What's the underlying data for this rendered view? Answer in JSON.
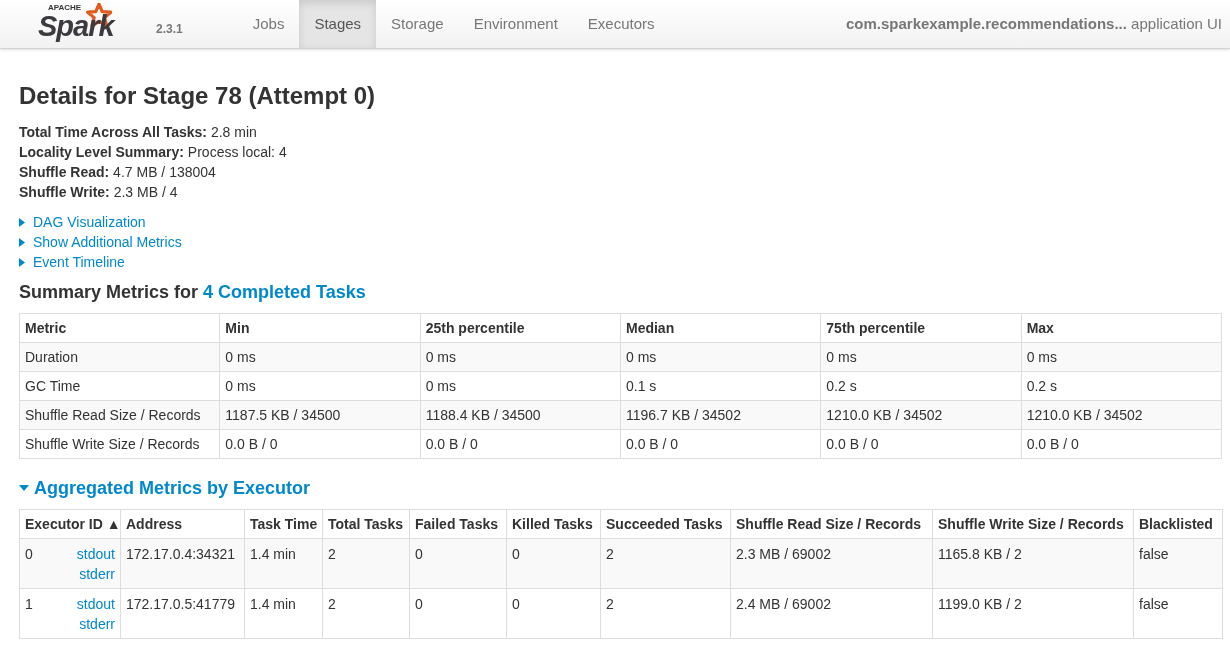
{
  "navbar": {
    "logo": {
      "small": "APACHE",
      "word": "Spark"
    },
    "version": "2.3.1",
    "tabs": [
      {
        "label": "Jobs",
        "selected": false
      },
      {
        "label": "Stages",
        "selected": true
      },
      {
        "label": "Storage",
        "selected": false
      },
      {
        "label": "Environment",
        "selected": false
      },
      {
        "label": "Executors",
        "selected": false
      }
    ],
    "app_name": "com.sparkexample.recommendations...",
    "app_suffix": "application UI"
  },
  "title": "Details for Stage 78 (Attempt 0)",
  "summary": [
    {
      "label": "Total Time Across All Tasks:",
      "value": "2.8 min"
    },
    {
      "label": "Locality Level Summary:",
      "value": "Process local: 4"
    },
    {
      "label": "Shuffle Read:",
      "value": "4.7 MB / 138004"
    },
    {
      "label": "Shuffle Write:",
      "value": "2.3 MB / 4"
    }
  ],
  "toggles": [
    {
      "label": "DAG Visualization",
      "expanded": false
    },
    {
      "label": "Show Additional Metrics",
      "expanded": false
    },
    {
      "label": "Event Timeline",
      "expanded": false
    }
  ],
  "summary_metrics": {
    "heading": "Summary Metrics for",
    "link": "4 Completed Tasks",
    "columns": [
      "Metric",
      "Min",
      "25th percentile",
      "Median",
      "75th percentile",
      "Max"
    ],
    "rows": [
      [
        "Duration",
        "0 ms",
        "0 ms",
        "0 ms",
        "0 ms",
        "0 ms"
      ],
      [
        "GC Time",
        "0 ms",
        "0 ms",
        "0.1 s",
        "0.2 s",
        "0.2 s"
      ],
      [
        "Shuffle Read Size / Records",
        "1187.5 KB / 34500",
        "1188.4 KB / 34500",
        "1196.7 KB / 34502",
        "1210.0 KB / 34502",
        "1210.0 KB / 34502"
      ],
      [
        "Shuffle Write Size / Records",
        "0.0 B / 0",
        "0.0 B / 0",
        "0.0 B / 0",
        "0.0 B / 0",
        "0.0 B / 0"
      ]
    ]
  },
  "executor_metrics": {
    "heading": "Aggregated Metrics by Executor",
    "expanded": true,
    "columns": [
      {
        "label": "Executor ID",
        "sort_glyph": "▲"
      },
      {
        "label": "Address"
      },
      {
        "label": "Task Time"
      },
      {
        "label": "Total Tasks"
      },
      {
        "label": "Failed Tasks"
      },
      {
        "label": "Killed Tasks"
      },
      {
        "label": "Succeeded Tasks"
      },
      {
        "label": "Shuffle Read Size / Records"
      },
      {
        "label": "Shuffle Write Size / Records"
      },
      {
        "label": "Blacklisted"
      }
    ],
    "rows": [
      {
        "cells": [
          {
            "text": "0",
            "links": [
              "stdout",
              "stderr"
            ]
          },
          "172.17.0.4:34321",
          "1.4 min",
          "2",
          "0",
          "0",
          "2",
          "2.3 MB / 69002",
          "1165.8 KB / 2",
          "false"
        ]
      },
      {
        "cells": [
          {
            "text": "1",
            "links": [
              "stdout",
              "stderr"
            ]
          },
          "172.17.0.5:41779",
          "1.4 min",
          "2",
          "0",
          "0",
          "2",
          "2.4 MB / 69002",
          "1199.0 KB / 2",
          "false"
        ]
      }
    ]
  }
}
